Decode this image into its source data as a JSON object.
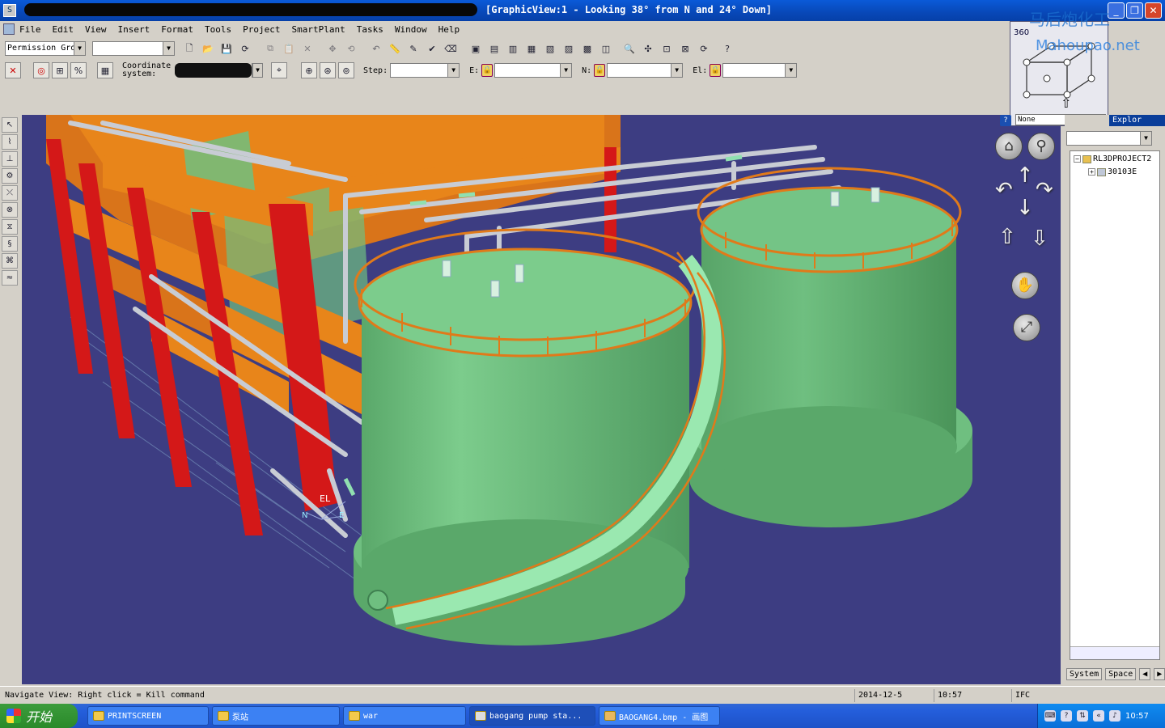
{
  "window": {
    "title": "[GraphicView:1 - Looking 38° from N and 24° Down]",
    "buttons": {
      "minimize": "_",
      "maximize": "❐",
      "close": "✕"
    }
  },
  "menu": [
    "File",
    "Edit",
    "View",
    "Insert",
    "Format",
    "Tools",
    "Project",
    "SmartPlant",
    "Tasks",
    "Window",
    "Help"
  ],
  "toolbar1": {
    "permission_group": "Permission Gro",
    "second_combo": ""
  },
  "toolbar2": {
    "coordinate_label": "Coordinate\nsystem:",
    "step_label": "Step:",
    "e_label": "E:",
    "n_label": "N:",
    "el_label": "El:"
  },
  "view_cube": {
    "degrees": "360",
    "view_name": "None"
  },
  "watermark": {
    "line1": "马后炮化工",
    "line2": "Mahoupao.net"
  },
  "viewport": {
    "axis_labels": {
      "el": "EL",
      "n": "N",
      "e": "E"
    }
  },
  "explorer": {
    "header": "Explor",
    "help": "?",
    "tree": [
      {
        "label": "RL3DPROJECT2",
        "expand": "−"
      },
      {
        "label": "30103E",
        "expand": "+"
      }
    ],
    "tabs": [
      "System",
      "Space"
    ]
  },
  "status": {
    "message": "Navigate View: Right click = Kill command",
    "date": "2014-12-5",
    "time": "10:57",
    "status_code": "IFC"
  },
  "taskbar": {
    "start": "开始",
    "tasks": [
      {
        "label": "PRINTSCREEN",
        "active": false
      },
      {
        "label": "泵站",
        "active": false
      },
      {
        "label": "war",
        "active": false
      },
      {
        "label": "baogang pump sta...",
        "active": true
      },
      {
        "label": "BAOGANG4.bmp - 画图",
        "active": false
      }
    ],
    "clock": "10:57"
  },
  "colors": {
    "viewport_bg": "#3d3d82",
    "tank": "#6fbf80",
    "railing": "#e07a1a",
    "steel_orange": "#e8851a",
    "steel_red": "#d41818",
    "pipe": "#c8ccd4"
  }
}
